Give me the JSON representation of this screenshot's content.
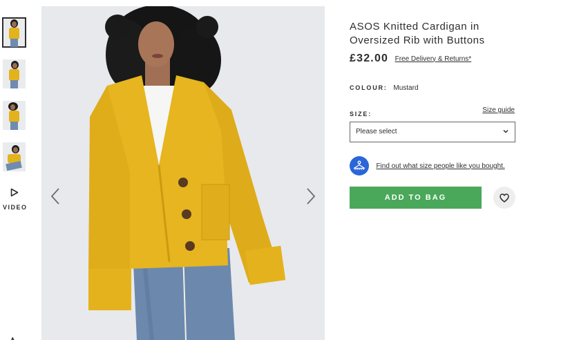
{
  "thumbnails": [
    {
      "name": "thumb-1",
      "active": true
    },
    {
      "name": "thumb-2",
      "active": false
    },
    {
      "name": "thumb-3",
      "active": false
    },
    {
      "name": "thumb-4",
      "active": false
    }
  ],
  "video": {
    "label": "VIDEO",
    "icon": "play-icon"
  },
  "gallery": {
    "prev_icon": "chevron-left-icon",
    "next_icon": "chevron-right-icon"
  },
  "product": {
    "title": "ASOS Knitted Cardigan in Oversized Rib with Buttons",
    "price": "£32.00",
    "delivery_link": "Free Delivery & Returns*",
    "colour_label": "COLOUR:",
    "colour_value": "Mustard",
    "size_label": "SIZE:",
    "size_guide": "Size guide",
    "size_select_value": "Please select",
    "fit_link": "Find out what size people like you bought.",
    "add_to_bag": "ADD TO BAG"
  },
  "colors": {
    "accent_green": "#4aa85a",
    "fit_icon_blue": "#2b66d9",
    "cardigan_mustard": "#e6b51f",
    "text": "#2d2d2d"
  }
}
